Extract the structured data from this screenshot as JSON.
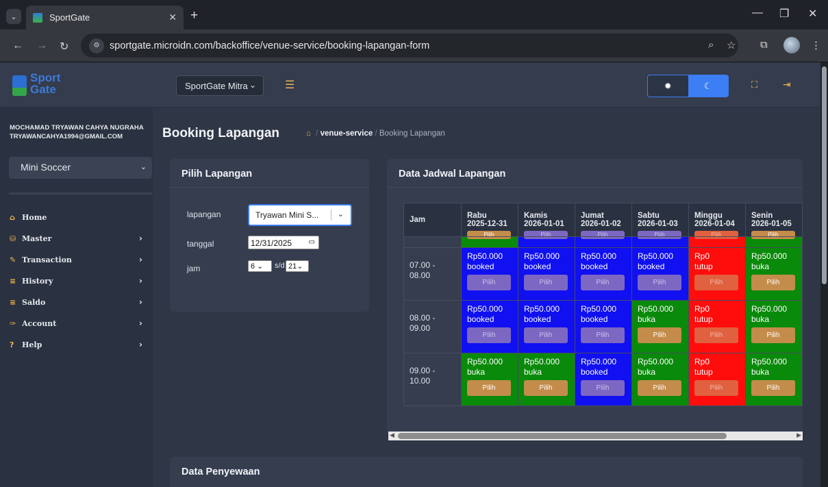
{
  "browser": {
    "tab_title": "SportGate",
    "url": "sportgate.microidn.com/backoffice/venue-service/booking-lapangan-form"
  },
  "topnav": {
    "logo_line1": "Sport",
    "logo_line2": "Gate",
    "venue_select": "SportGate Mitra",
    "accent": "#f0b74e",
    "theme_accent": "#3c7ef3"
  },
  "sidebar": {
    "user_name": "MOCHAMAD TRYAWAN CAHYA NUGRAHA",
    "user_email": "TRYAWANCAHYA1994@GMAIL.COM",
    "sport_select": "Mini Soccer",
    "items": [
      {
        "label": "Home",
        "icon": "home-icon"
      },
      {
        "label": "Master",
        "icon": "database-icon"
      },
      {
        "label": "Transaction",
        "icon": "edit-icon"
      },
      {
        "label": "History",
        "icon": "list-icon"
      },
      {
        "label": "Saldo",
        "icon": "list-icon"
      },
      {
        "label": "Account",
        "icon": "wrench-icon"
      },
      {
        "label": "Help",
        "icon": "help-icon"
      }
    ]
  },
  "page": {
    "title": "Booking Lapangan",
    "breadcrumb_parent": "venue-service",
    "breadcrumb_current": "Booking Lapangan"
  },
  "pilih": {
    "title": "Pilih Lapangan",
    "lapangan_label": "lapangan",
    "lapangan_value": "Tryawan Mini S...",
    "tanggal_label": "tanggal",
    "tanggal_value": "12/31/2025",
    "jam_label": "jam",
    "jam_from": "6",
    "jam_sep": "s/d",
    "jam_to": "21"
  },
  "jadwal": {
    "title": "Data Jadwal Lapangan",
    "jam_header": "Jam",
    "days": [
      {
        "day": "Rabu",
        "date": "2025-12-31"
      },
      {
        "day": "Kamis",
        "date": "2026-01-01"
      },
      {
        "day": "Jumat",
        "date": "2026-01-02"
      },
      {
        "day": "Sabtu",
        "date": "2026-01-03"
      },
      {
        "day": "Minggu",
        "date": "2026-01-04"
      },
      {
        "day": "Senin",
        "date": "2026-01-05"
      }
    ],
    "btn_label": "Pilih",
    "rows": [
      {
        "jam": "07.00 - 08.00",
        "cells": [
          {
            "price": "Rp50.000",
            "status": "booked"
          },
          {
            "price": "Rp50.000",
            "status": "booked"
          },
          {
            "price": "Rp50.000",
            "status": "booked"
          },
          {
            "price": "Rp50.000",
            "status": "booked"
          },
          {
            "price": "Rp0",
            "status": "tutup"
          },
          {
            "price": "Rp50.000",
            "status": "buka"
          }
        ]
      },
      {
        "jam": "08.00 - 09.00",
        "cells": [
          {
            "price": "Rp50.000",
            "status": "booked"
          },
          {
            "price": "Rp50.000",
            "status": "booked"
          },
          {
            "price": "Rp50.000",
            "status": "booked"
          },
          {
            "price": "Rp50.000",
            "status": "buka"
          },
          {
            "price": "Rp0",
            "status": "tutup"
          },
          {
            "price": "Rp50.000",
            "status": "buka"
          }
        ]
      },
      {
        "jam": "09.00 - 10.00",
        "cells": [
          {
            "price": "Rp50.000",
            "status": "buka"
          },
          {
            "price": "Rp50.000",
            "status": "buka"
          },
          {
            "price": "Rp50.000",
            "status": "booked"
          },
          {
            "price": "Rp50.000",
            "status": "buka"
          },
          {
            "price": "Rp0",
            "status": "tutup"
          },
          {
            "price": "Rp50.000",
            "status": "buka"
          }
        ]
      }
    ],
    "status_colors": {
      "booked": "#1010f0",
      "buka": "#0a8a0a",
      "tutup": "#ff0d0d"
    }
  },
  "sewa": {
    "title": "Data Penyewaan"
  }
}
